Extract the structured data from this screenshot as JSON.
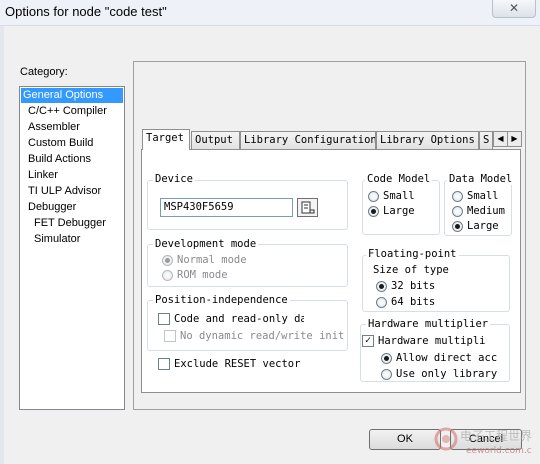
{
  "window": {
    "title": "Options for node \"code test\"",
    "close_glyph": "✕"
  },
  "category": {
    "label": "Category:",
    "items": [
      "General Options",
      "C/C++ Compiler",
      "Assembler",
      "Custom Build",
      "Build Actions",
      "Linker",
      "TI ULP Advisor",
      "Debugger",
      "FET Debugger",
      "Simulator"
    ],
    "selected": "General Options"
  },
  "tabs": [
    "Target",
    "Output",
    "Library Configuration",
    "Library Options",
    "S"
  ],
  "active_tab": "Target",
  "tab_scroll": {
    "left": "◀",
    "right": "▶"
  },
  "device": {
    "label": "Device",
    "value": "MSP430F5659"
  },
  "dev_mode": {
    "label": "Development mode",
    "options": [
      "Normal mode",
      "ROM mode"
    ],
    "selected": "Normal mode",
    "enabled": false
  },
  "pos_indep": {
    "label": "Position-independence",
    "code_ro": "Code and read-only da",
    "code_ro_checked": false,
    "no_dyn": "No dynamic read/write initi",
    "no_dyn_enabled": false
  },
  "exclude_reset": {
    "label": "Exclude RESET vector",
    "checked": false
  },
  "code_model": {
    "label": "Code Model",
    "options": [
      "Small",
      "Large"
    ],
    "selected": "Large"
  },
  "data_model": {
    "label": "Data Model",
    "options": [
      "Small",
      "Medium",
      "Large"
    ],
    "selected": "Large"
  },
  "floating_point": {
    "label": "Floating-point",
    "size_label": "Size of type",
    "options": [
      "32 bits",
      "64 bits"
    ],
    "selected": "32 bits"
  },
  "hw_mult": {
    "label": "Hardware multiplier",
    "check_label": "Hardware multipli",
    "checked": true,
    "options": [
      "Allow direct acc",
      "Use only library"
    ],
    "selected": "Allow direct acc"
  },
  "buttons": {
    "ok": "OK",
    "cancel": "Cancel"
  },
  "watermark": {
    "text": "eeworld.com.cn",
    "logo": "电子工程世界"
  },
  "colors": {
    "selection": "#3399ff",
    "dialog_bg": "#f0f0f0"
  }
}
